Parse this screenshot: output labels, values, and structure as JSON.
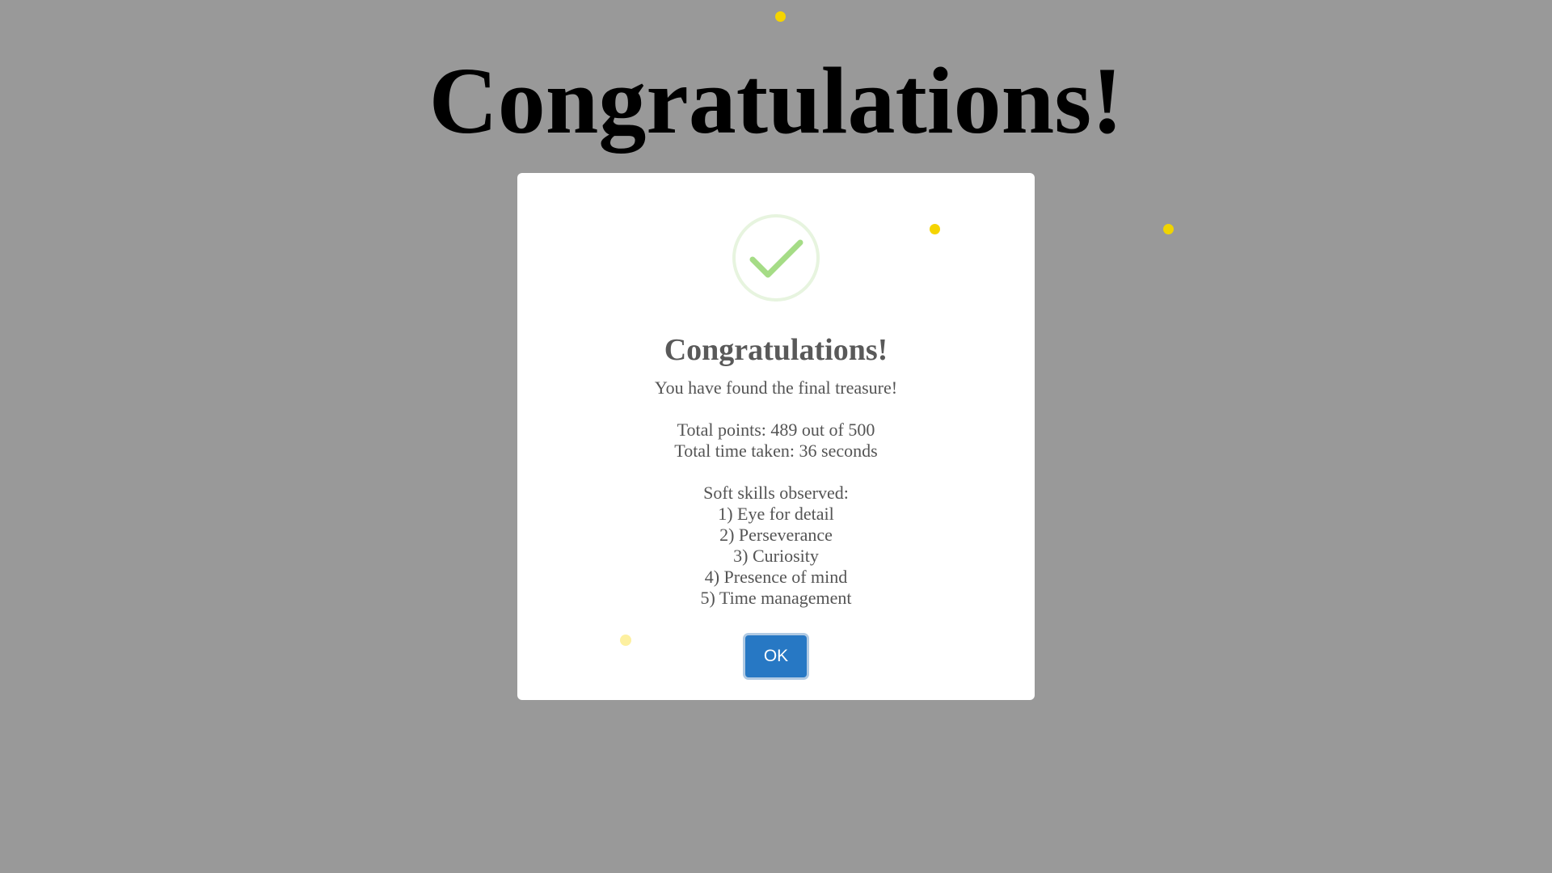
{
  "page": {
    "heading": "Congratulations!",
    "background_color": "#999999"
  },
  "confetti_color": "#f5d400",
  "dialog": {
    "icon": "success-check-icon",
    "icon_color": "#a5dc86",
    "title": "Congratulations!",
    "message": "You have found the final treasure!",
    "stats": [
      "Total points: 489 out of 500",
      "Total time taken: 36 seconds"
    ],
    "skills_heading": "Soft skills observed:",
    "skills": [
      "1) Eye for detail",
      "2) Perseverance",
      "3) Curiosity",
      "4) Presence of mind",
      "5) Time management"
    ],
    "ok_label": "OK",
    "ok_color": "#2778c4"
  }
}
